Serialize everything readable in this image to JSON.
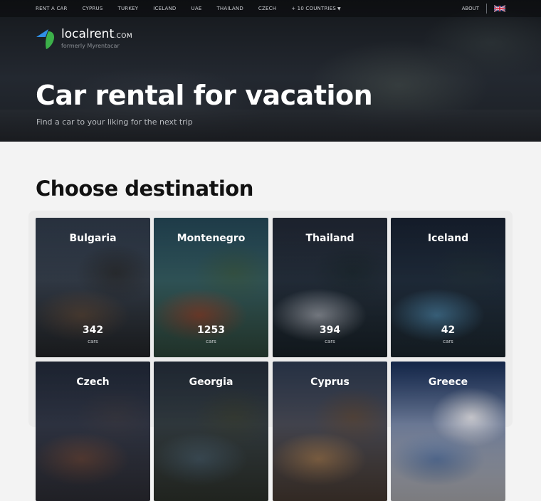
{
  "nav": {
    "items": [
      "RENT A CAR",
      "CYPRUS",
      "TURKEY",
      "ICELAND",
      "UAE",
      "THAILAND",
      "CZECH"
    ],
    "more": "+ 10 COUNTRIES",
    "about": "ABOUT",
    "language_icon": "uk-flag-icon"
  },
  "logo": {
    "name": "localrent",
    "tld": ".COM",
    "sub": "formerly Myrentacar",
    "colors": {
      "blue": "#2f8fe6",
      "green": "#3cb04a"
    }
  },
  "hero": {
    "title": "Car rental for vacation",
    "subtitle": "Find a car to your liking for the next trip"
  },
  "destinations": {
    "title": "Choose destination",
    "unit_label": "cars",
    "cards": [
      {
        "name": "Bulgaria",
        "count": "342",
        "palette": [
          "#3c4a5e",
          "#5b4a3e",
          "#2c2f33"
        ]
      },
      {
        "name": "Montenegro",
        "count": "1253",
        "palette": [
          "#2e5a6e",
          "#8a4a35",
          "#3a5a4a"
        ]
      },
      {
        "name": "Thailand",
        "count": "394",
        "palette": [
          "#2a3344",
          "#9aa0aa",
          "#1e2a32"
        ]
      },
      {
        "name": "Iceland",
        "count": "42",
        "palette": [
          "#1e2a3e",
          "#4a7ea0",
          "#22303a"
        ]
      },
      {
        "name": "Czech",
        "count": "",
        "palette": [
          "#2a3448",
          "#6a4a40",
          "#3a3a44"
        ]
      },
      {
        "name": "Georgia",
        "count": "",
        "palette": [
          "#2e3a4a",
          "#4a5e6a",
          "#3a4038"
        ]
      },
      {
        "name": "Cyprus",
        "count": "",
        "palette": [
          "#3a4a66",
          "#a07a55",
          "#5a4a40"
        ]
      },
      {
        "name": "Greece",
        "count": "",
        "palette": [
          "#1e3a6e",
          "#6a88b8",
          "#e0e0e6"
        ]
      }
    ]
  }
}
